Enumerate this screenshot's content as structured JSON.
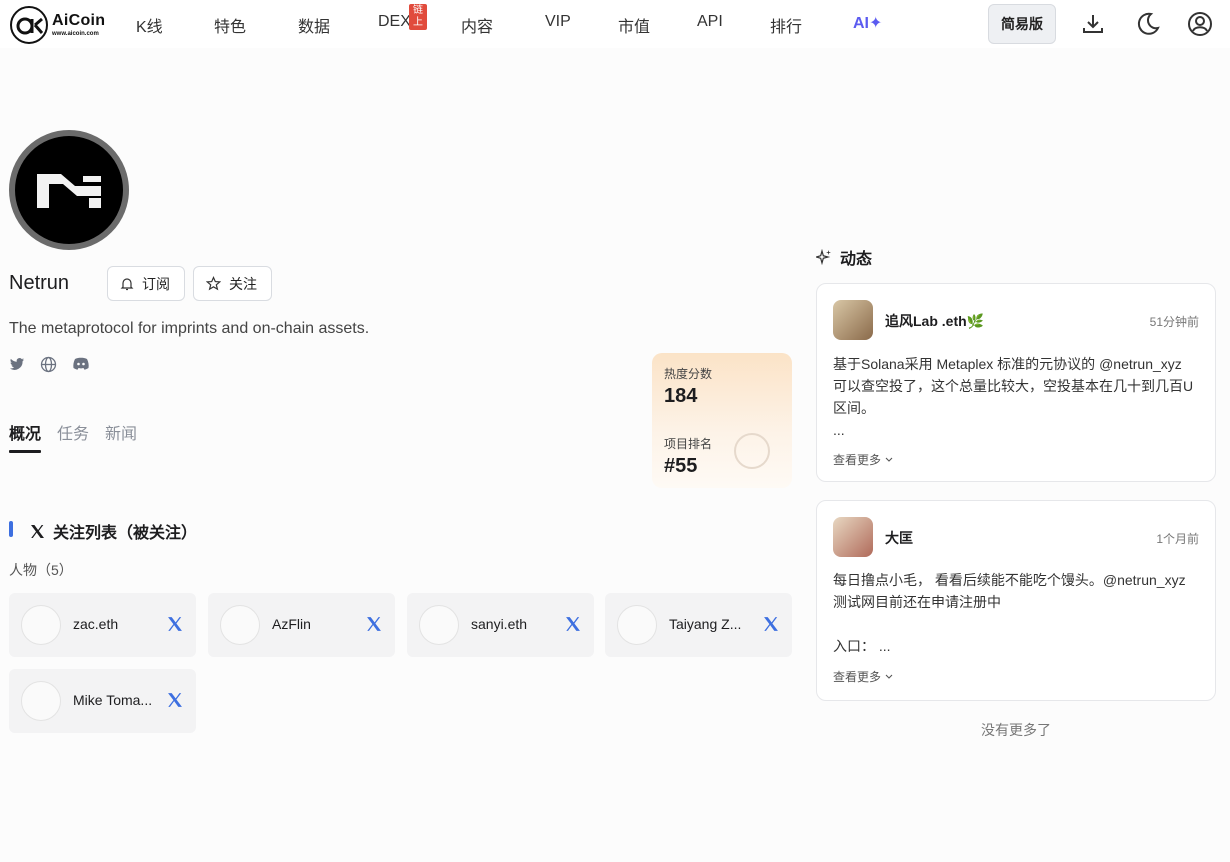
{
  "header": {
    "logo_name": "AiCoin",
    "logo_url": "www.aicoin.com",
    "nav": [
      {
        "label": "K线"
      },
      {
        "label": "特色"
      },
      {
        "label": "数据"
      },
      {
        "label": "DEX",
        "badge": "链上"
      },
      {
        "label": "内容"
      },
      {
        "label": "VIP"
      },
      {
        "label": "市值"
      },
      {
        "label": "API"
      },
      {
        "label": "排行"
      },
      {
        "label": "AI✦"
      }
    ],
    "simple_mode_label": "简易版",
    "icons": [
      "download-icon",
      "moon-icon",
      "user-icon"
    ]
  },
  "project": {
    "name": "Netrun",
    "subscribe_label": "订阅",
    "follow_label": "关注",
    "description": "The metaprotocol for imprints and on-chain assets.",
    "social_icons": [
      "twitter-icon",
      "globe-icon",
      "discord-icon"
    ]
  },
  "score_card": {
    "heat_label": "热度分数",
    "heat_value": "184",
    "rank_label": "项目排名",
    "rank_value": "#55"
  },
  "tabs": [
    {
      "label": "概况",
      "active": true
    },
    {
      "label": "任务",
      "active": false
    },
    {
      "label": "新闻",
      "active": false
    }
  ],
  "following": {
    "title": "关注列表（被关注）",
    "people_label": "人物（5）",
    "people": [
      {
        "name": "zac.eth"
      },
      {
        "name": "AzFlin"
      },
      {
        "name": "sanyi.eth"
      },
      {
        "name": "Taiyang Z..."
      },
      {
        "name": "Mike Toma..."
      }
    ]
  },
  "feed": {
    "title": "动态",
    "posts": [
      {
        "author": "追风Lab .eth🌿",
        "time": "51分钟前",
        "text": "基于Solana采用 Metaplex 标准的元协议的 @netrun_xyz\n可以查空投了，这个总量比较大，空投基本在几十到几百U\n区间。\n...",
        "more_label": "查看更多"
      },
      {
        "author": "大匡",
        "time": "1个月前",
        "text": "每日撸点小毛，  看看后续能不能吃个馒头。@netrun_xyz\n测试网目前还在申请注册中\n\n入口：  ...",
        "more_label": "查看更多"
      }
    ],
    "no_more": "没有更多了"
  },
  "colors": {
    "accent_blue": "#3d6fe0",
    "ai_purple": "#5b5bf0",
    "badge_red": "#e14b3c"
  }
}
